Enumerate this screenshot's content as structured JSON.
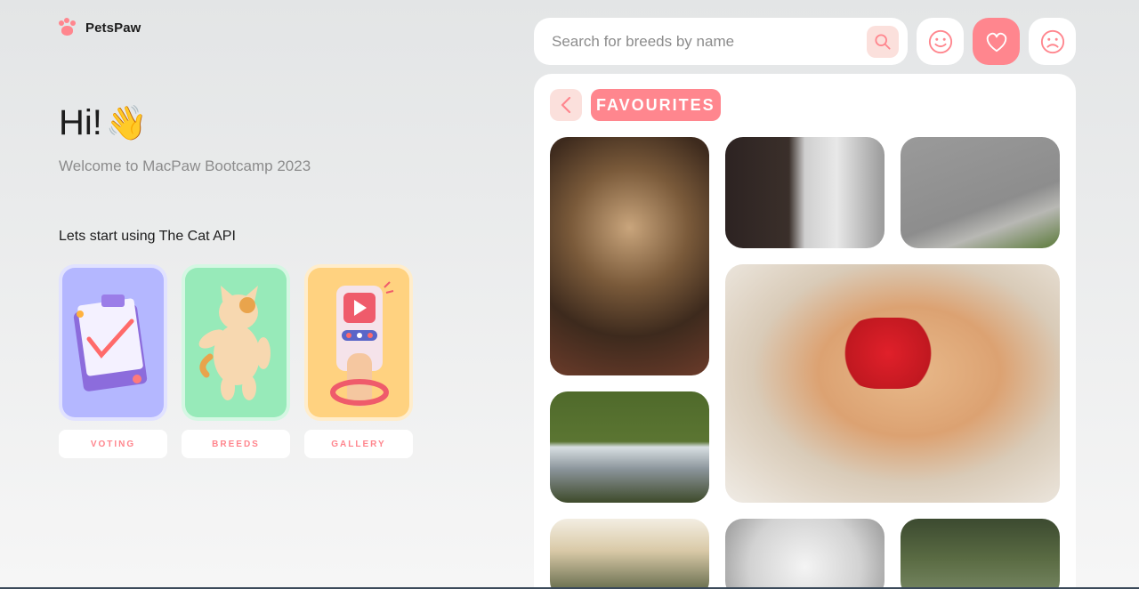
{
  "app": {
    "name": "PetsPaw"
  },
  "greeting": {
    "title": "Hi!",
    "emoji": "👋",
    "subtitle": "Welcome to MacPaw Bootcamp 2023"
  },
  "intro": {
    "prompt": "Lets start using The Cat API"
  },
  "nav_cards": [
    {
      "label": "VOTING",
      "color": "#b4b7ff",
      "icon": "clipboard-checklist-illustration"
    },
    {
      "label": "BREEDS",
      "color": "#97eab9",
      "icon": "cat-figure-illustration"
    },
    {
      "label": "GALLERY",
      "color": "#ffd280",
      "icon": "phone-in-hand-illustration"
    }
  ],
  "search": {
    "placeholder": "Search for breeds by name",
    "value": ""
  },
  "header_icons": [
    {
      "name": "likes-smile-icon",
      "active": false
    },
    {
      "name": "favourites-heart-icon",
      "active": true
    },
    {
      "name": "dislikes-sad-icon",
      "active": false
    }
  ],
  "section": {
    "title": "FAVOURITES"
  },
  "gallery": {
    "photos": [
      {
        "name": "photo-tabby-kitten"
      },
      {
        "name": "photo-cat-air-conditioner"
      },
      {
        "name": "photo-cat-on-pavement"
      },
      {
        "name": "photo-ginger-cat-red-bow"
      },
      {
        "name": "photo-kittens-milk-bucket"
      },
      {
        "name": "photo-bird-and-cat"
      },
      {
        "name": "photo-white-cat"
      },
      {
        "name": "photo-cat-outdoors"
      }
    ]
  },
  "colors": {
    "accent": "#ff868e",
    "accent_light": "#fbe0dc",
    "text": "#1d1d1d",
    "muted": "#8c8c8c"
  }
}
